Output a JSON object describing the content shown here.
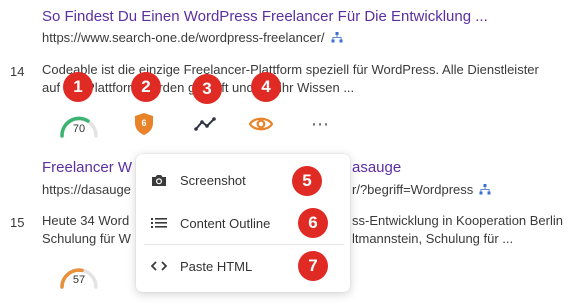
{
  "results": [
    {
      "title": "So Findest Du Einen WordPress Freelancer Für Die Entwicklung ...",
      "url": "https://www.search-one.de/wordpress-freelancer/",
      "rank": "14",
      "desc_line1": "Codeable ist die einzige Freelancer-Plattform speziell für WordPress. Alle Dienstleister",
      "desc_line2": "auf der Plattform werden geprüft und auf ihr Wissen ...",
      "score": "70",
      "shield_value": "6"
    },
    {
      "title": "Freelancer W",
      "title_tail": "asauge",
      "url": "https://dasauge",
      "url_tail": "r/?begriff=Wordpress",
      "rank": "15",
      "desc_line1": "Heute 34 Word",
      "desc_line1_tail": "ss-Entwicklung in Kooperation Berlin",
      "desc_line2": "Schulung für W",
      "desc_line2_tail": "ltmannstein, Schulung für ...",
      "score": "57"
    }
  ],
  "badges": [
    "1",
    "2",
    "3",
    "4",
    "5",
    "6",
    "7"
  ],
  "menu": {
    "items": [
      {
        "label": "Screenshot",
        "icon": "camera-icon"
      },
      {
        "label": "Content Outline",
        "icon": "list-icon"
      },
      {
        "label": "Paste HTML",
        "icon": "code-icon"
      }
    ]
  },
  "colors": {
    "title": "#5b2fa1",
    "badge": "#e02a24",
    "gauge_green": "#3cb371",
    "gauge_orange": "#e8913a",
    "shield": "#e8832a",
    "eye": "#e8832a",
    "sitemap": "#3b6fd1"
  }
}
